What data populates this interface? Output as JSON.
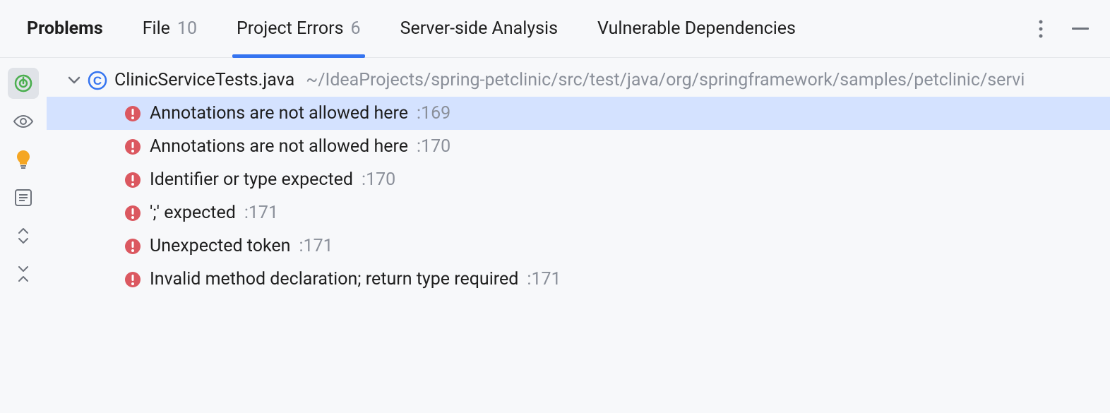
{
  "tabs": [
    {
      "label": "Problems",
      "count": null,
      "bold": true,
      "active": false
    },
    {
      "label": "File",
      "count": "10",
      "bold": false,
      "active": false
    },
    {
      "label": "Project Errors",
      "count": "6",
      "bold": false,
      "active": true
    },
    {
      "label": "Server-side Analysis",
      "count": null,
      "bold": false,
      "active": false
    },
    {
      "label": "Vulnerable Dependencies",
      "count": null,
      "bold": false,
      "active": false
    }
  ],
  "file": {
    "name": "ClinicServiceTests.java",
    "path": "~/IdeaProjects/spring-petclinic/src/test/java/org/springframework/samples/petclinic/servi"
  },
  "errors": [
    {
      "message": "Annotations are not allowed here",
      "line": ":169",
      "selected": true
    },
    {
      "message": "Annotations are not allowed here",
      "line": ":170",
      "selected": false
    },
    {
      "message": "Identifier or type expected",
      "line": ":170",
      "selected": false
    },
    {
      "message": "';' expected",
      "line": ":171",
      "selected": false
    },
    {
      "message": "Unexpected token",
      "line": ":171",
      "selected": false
    },
    {
      "message": "Invalid method declaration; return type required",
      "line": ":171",
      "selected": false
    }
  ]
}
